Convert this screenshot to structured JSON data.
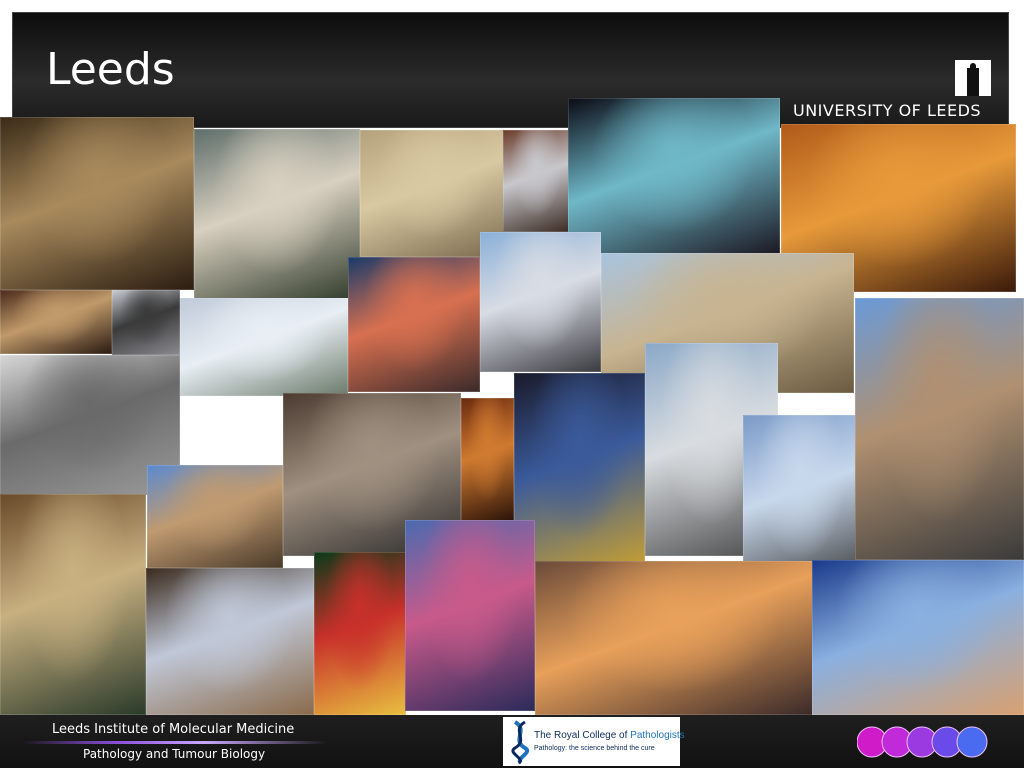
{
  "slide": {
    "title": "Leeds",
    "university_logo_text": "UNIVERSITY OF LEEDS",
    "university_logo_icon": "parkinson-tower-icon"
  },
  "collage": {
    "photos": [
      {
        "name": "photo-arcade-interior",
        "colors": [
          "#3a2a18",
          "#a88a5c",
          "#2a1c10"
        ]
      },
      {
        "name": "photo-street-lamp-alley",
        "colors": [
          "#5e6e6a",
          "#d8d0c0",
          "#2f3a2a"
        ]
      },
      {
        "name": "photo-stone-building-steps",
        "colors": [
          "#b5a27c",
          "#d9c9a2",
          "#7a6a4e"
        ]
      },
      {
        "name": "photo-sphere-sculpture",
        "colors": [
          "#6b3b2a",
          "#c8c8cc",
          "#3a2a22"
        ]
      },
      {
        "name": "photo-parkinson-building-night",
        "colors": [
          "#0a0a14",
          "#6fb8c8",
          "#1a1620"
        ]
      },
      {
        "name": "photo-river-aire-night",
        "colors": [
          "#b05a1a",
          "#e89a3a",
          "#3a1a0a"
        ]
      },
      {
        "name": "photo-shop-interior",
        "colors": [
          "#4a2a1c",
          "#c09a6a",
          "#2a1a12"
        ]
      },
      {
        "name": "photo-equestrian-statue",
        "colors": [
          "#c8ccd4",
          "#3a3a3a",
          "#8a8a90"
        ]
      },
      {
        "name": "photo-fountains-civic",
        "colors": [
          "#bfc9d8",
          "#e8eef4",
          "#6a7a6a"
        ]
      },
      {
        "name": "photo-town-hall-sunset",
        "colors": [
          "#1a3a6a",
          "#d87050",
          "#3a2a2a"
        ]
      },
      {
        "name": "photo-spires-parkinson",
        "colors": [
          "#8ab0d8",
          "#d8dce4",
          "#3a3a40"
        ]
      },
      {
        "name": "photo-town-hall-columns",
        "colors": [
          "#a8c4e0",
          "#c8b490",
          "#6a5a40"
        ]
      },
      {
        "name": "photo-brutalist-building",
        "colors": [
          "#d8d8d8",
          "#6a6a6a",
          "#9a9a9a"
        ]
      },
      {
        "name": "photo-victoria-quarter-street",
        "colors": [
          "#4a3a30",
          "#a09080",
          "#2a2a2a"
        ]
      },
      {
        "name": "photo-bar-interior",
        "colors": [
          "#6a2a10",
          "#d07a30",
          "#2a1208"
        ]
      },
      {
        "name": "photo-wish-you-were-here-sign",
        "colors": [
          "#1a1a2a",
          "#3a5a9a",
          "#c8a030"
        ]
      },
      {
        "name": "photo-harvey-nichols-facade",
        "colors": [
          "#8aa8c8",
          "#d8dce0",
          "#4a4a4a"
        ]
      },
      {
        "name": "photo-statue-civic",
        "colors": [
          "#7a9ac8",
          "#c8d8ec",
          "#3a3a3a"
        ]
      },
      {
        "name": "photo-town-hall-street",
        "colors": [
          "#6a9ad8",
          "#b09070",
          "#3a3a3a"
        ]
      },
      {
        "name": "photo-corn-exchange",
        "colors": [
          "#5a8ad0",
          "#c09a70",
          "#4a3a2a"
        ]
      },
      {
        "name": "photo-county-arcade",
        "colors": [
          "#6a4a2a",
          "#c8b080",
          "#2a3a2a"
        ]
      },
      {
        "name": "photo-harvey-nichols-window",
        "colors": [
          "#3a2a1c",
          "#c0c8d8",
          "#8a6a4a"
        ]
      },
      {
        "name": "photo-city-varieties-poster",
        "colors": [
          "#0a3a1a",
          "#c8302a",
          "#e8c040"
        ]
      },
      {
        "name": "photo-ferris-wheel-night",
        "colors": [
          "#4a6ab0",
          "#c85a8a",
          "#2a2a5a"
        ]
      },
      {
        "name": "photo-christmas-market-aerial",
        "colors": [
          "#6a4a3a",
          "#e8a05a",
          "#3a2a2a"
        ]
      },
      {
        "name": "photo-civic-hall-dusk",
        "colors": [
          "#1a3a8a",
          "#8ab0e0",
          "#d8a070"
        ]
      }
    ]
  },
  "footer": {
    "institute": "Leeds Institute of Molecular Medicine",
    "department": "Pathology and Tumour Biology",
    "rcp_name_part1": "The Royal College of ",
    "rcp_name_part2": "Pathologists",
    "rcp_tagline": "Pathology: the science behind the cure",
    "rcp_icon": "dna-helix-icon",
    "decoration_icon": "cell-spheres-icon",
    "dot_colors": [
      "#d01cc8",
      "#c02ad8",
      "#9a3ae0",
      "#6a4ae8",
      "#4a6af0"
    ]
  }
}
